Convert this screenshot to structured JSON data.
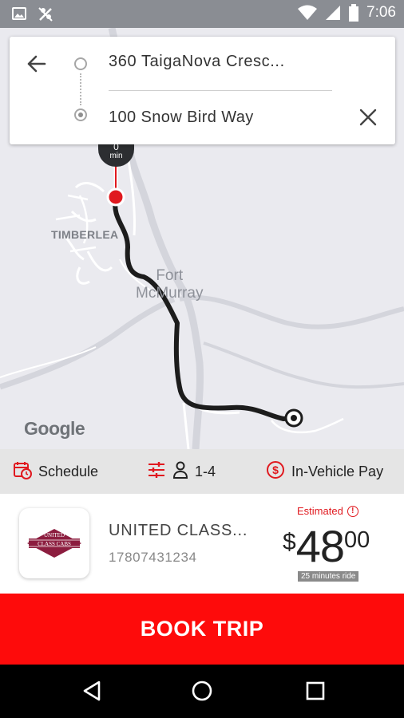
{
  "status_bar": {
    "time": "7:06",
    "icons": [
      "image-icon",
      "signal-off-icon",
      "wifi-icon",
      "signal-icon",
      "battery-icon"
    ]
  },
  "map": {
    "labels": {
      "timberlea": "TIMBERLEA",
      "fort_line1": "Fort",
      "fort_line2": "McMurray"
    },
    "attribution": "Google",
    "eta_value": "0",
    "eta_unit": "min"
  },
  "trip": {
    "origin": "360 TaigaNova Cresc...",
    "destination": "100 Snow Bird Way"
  },
  "options": {
    "schedule_label": "Schedule",
    "passengers_label": "1-4",
    "payment_label": "In-Vehicle Pay"
  },
  "cab": {
    "name": "UNITED CLASS...",
    "phone": "17807431234",
    "logo_text": "UNITED CLASS CABS",
    "estimated_label": "Estimated",
    "currency": "$",
    "price_dollars": "48",
    "price_cents": "00",
    "ride_time": "25 minutes ride"
  },
  "book_button": {
    "label": "BOOK TRIP"
  },
  "colors": {
    "accent": "#fe0b0b",
    "route": "#1c1c1c",
    "status_bar": "#8a8d93"
  }
}
